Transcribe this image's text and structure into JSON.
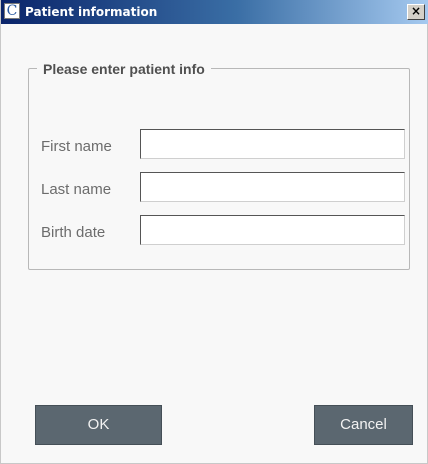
{
  "window": {
    "title": "Patient information",
    "icon": "app-c-icon",
    "close_glyph": "✕"
  },
  "group": {
    "title": "Please enter patient info"
  },
  "fields": [
    {
      "label": "First name",
      "value": "",
      "placeholder": ""
    },
    {
      "label": "Last name",
      "value": "",
      "placeholder": ""
    },
    {
      "label": "Birth date",
      "value": "",
      "placeholder": ""
    }
  ],
  "buttons": {
    "ok_label": "OK",
    "cancel_label": "Cancel"
  },
  "colors": {
    "titlebar_start": "#0a246a",
    "titlebar_end": "#a6caf0",
    "button_bg": "#5b6770"
  }
}
